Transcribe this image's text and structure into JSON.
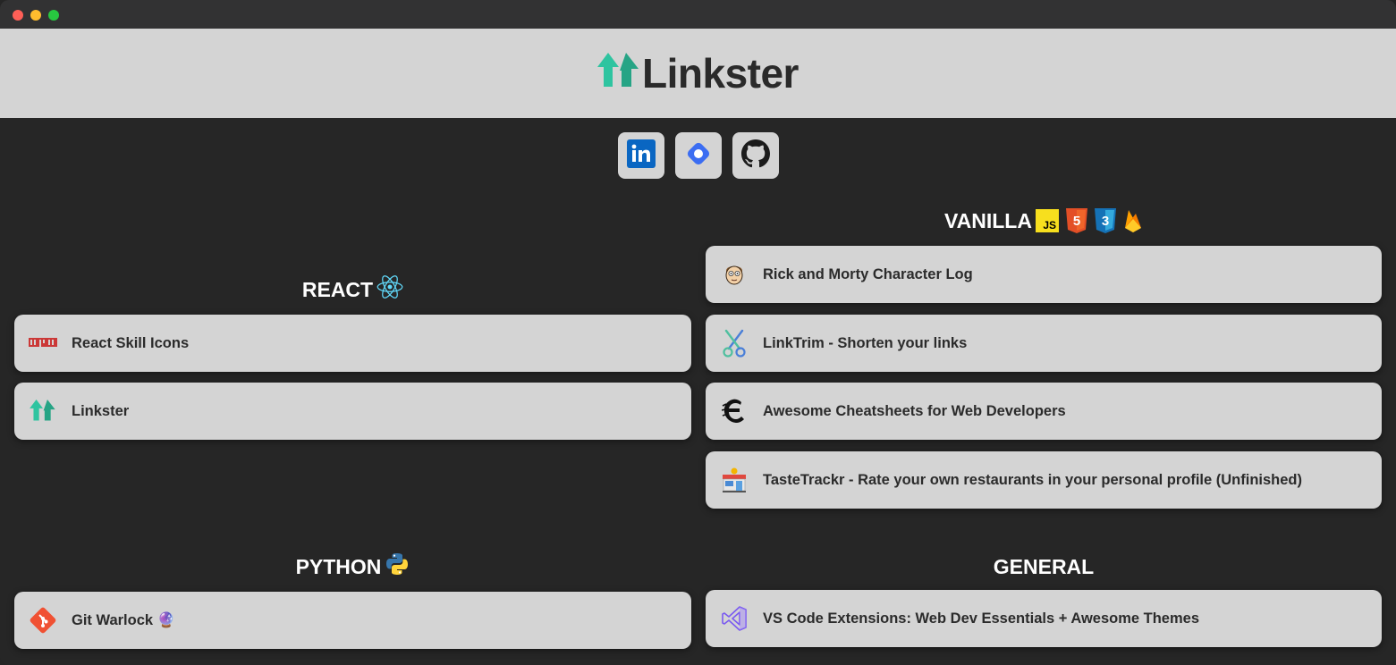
{
  "app": {
    "brand": "Linkster"
  },
  "socials": [
    {
      "name": "linkedin"
    },
    {
      "name": "portfolio"
    },
    {
      "name": "github"
    }
  ],
  "sections": {
    "react": {
      "title": "REACT",
      "links": [
        {
          "label": "React Skill Icons",
          "icon": "npm-icon"
        },
        {
          "label": "Linkster",
          "icon": "linkster-icon"
        }
      ]
    },
    "vanilla": {
      "title": "VANILLA",
      "badges": [
        "JS",
        "5",
        "3"
      ],
      "links": [
        {
          "label": "Rick and Morty Character Log",
          "icon": "morty-icon"
        },
        {
          "label": "LinkTrim - Shorten your links",
          "icon": "scissors-icon"
        },
        {
          "label": "Awesome Cheatsheets for Web Developers",
          "icon": "cheatsheets-icon"
        },
        {
          "label": "TasteTrackr - Rate your own restaurants in your personal profile (Unfinished)",
          "icon": "restaurant-icon"
        }
      ]
    },
    "python": {
      "title": "PYTHON",
      "links": [
        {
          "label": "Git Warlock 🔮",
          "icon": "git-icon"
        }
      ]
    },
    "general": {
      "title": "GENERAL",
      "links": [
        {
          "label": "VS Code Extensions: Web Dev Essentials + Awesome Themes",
          "icon": "vscode-icon"
        }
      ]
    }
  },
  "colors": {
    "background": "#262626",
    "card": "#d4d4d4",
    "accent": "#2ec4a0",
    "text_dark": "#2b2b2b"
  }
}
